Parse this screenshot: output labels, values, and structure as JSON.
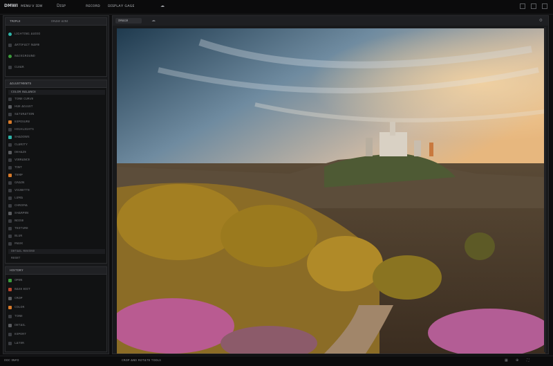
{
  "menu": {
    "app_name": "DMWI",
    "items": [
      "ᴍᴇɴᴜ",
      "ᴠ ɪᴇᴡ",
      "Dɪsᴘ"
    ],
    "info": [
      "ʀᴇᴄᴏʀᴅ",
      "ᴅɪsᴘʟᴀʏ ɢᴀɢᴇ"
    ]
  },
  "left": {
    "top_panel": {
      "title": "ᴛʀɪᴘʟᴇ",
      "tab": "ᴅʀᴀᴡ ᴀɪɴɪ",
      "rows": [
        {
          "label": "ʟɪɢʜᴛɪɴɢ ᴀᴜᴅɪᴏ",
          "value": ""
        },
        {
          "label": "ᴀʀᴛɪғᴀᴄᴛ ɴᴀᴍᴇ",
          "value": ""
        },
        {
          "label": "ʙᴀᴄᴋɢʀᴏᴜɴᴅ",
          "value": ""
        },
        {
          "label": "ᴄʟᴇᴀʀ",
          "value": ""
        }
      ]
    },
    "layers_panel": {
      "title": "ᴀᴅᴊᴜsᴛᴍᴇɴᴛs",
      "section": "ᴄᴏʟᴏʀ ʙᴀʟᴀɴᴄᴇ",
      "rows": [
        {
          "label": "ᴛᴏɴᴇ ᴄᴜʀᴠᴇ",
          "value": ""
        },
        {
          "label": "ʜᴜᴇ ᴀᴅᴊᴜsᴛ",
          "value": ""
        },
        {
          "label": "sᴀᴛᴜʀᴀᴛɪᴏɴ",
          "value": ""
        },
        {
          "label": "ᴇxᴘᴏsᴜʀᴇ",
          "value": ""
        },
        {
          "label": "ʜɪɢʜʟɪɢʜᴛs",
          "value": ""
        },
        {
          "label": "sʜᴀᴅᴏᴡs",
          "value": ""
        },
        {
          "label": "ᴄʟᴀʀɪᴛʏ",
          "value": ""
        },
        {
          "label": "ᴅᴇʜᴀᴢᴇ",
          "value": ""
        },
        {
          "label": "ᴠɪʙʀᴀɴᴄᴇ",
          "value": ""
        },
        {
          "label": "ᴛɪɴᴛ",
          "value": ""
        },
        {
          "label": "ᴛᴇᴍᴘ",
          "value": ""
        },
        {
          "label": "ɢʀᴀɪɴ",
          "value": ""
        },
        {
          "label": "ᴠɪɢɴᴇᴛᴛᴇ",
          "value": ""
        },
        {
          "label": "ʟᴜᴍᴀ",
          "value": ""
        },
        {
          "label": "ᴄʜʀᴏᴍᴀ",
          "value": ""
        },
        {
          "label": "sʜᴀʀᴘᴇɴ",
          "value": ""
        },
        {
          "label": "ɴᴏɪsᴇ",
          "value": ""
        },
        {
          "label": "ᴛᴇxᴛᴜʀᴇ",
          "value": ""
        },
        {
          "label": "ʙʟᴜʀ",
          "value": ""
        },
        {
          "label": "ᴍᴀsᴋ",
          "value": ""
        }
      ],
      "footer": "ᴅᴇᴛᴀɪʟ ʀᴇᴠɪᴇᴡ",
      "footer2": "ʀᴇsᴇᴛ"
    },
    "bottom_panel": {
      "title": "ʜɪsᴛᴏʀʏ",
      "rows": [
        {
          "label": "ᴏᴘᴇɴ",
          "value": ""
        },
        {
          "label": "ʙᴀsᴇ ᴇᴅɪᴛ",
          "value": ""
        },
        {
          "label": "ᴄʀᴏᴘ",
          "value": ""
        },
        {
          "label": "ᴄᴏʟᴏʀ",
          "value": ""
        },
        {
          "label": "ᴛᴏɴᴇ",
          "value": ""
        },
        {
          "label": "ᴅᴇᴛᴀɪʟ",
          "value": ""
        },
        {
          "label": "ᴇxᴘᴏʀᴛ",
          "value": ""
        },
        {
          "label": "ʟᴀʏᴇʀ",
          "value": ""
        }
      ]
    }
  },
  "main": {
    "tab_label": "ɪᴍᴀɢᴇ",
    "image_alt": "castle-on-hill-landscape"
  },
  "status": {
    "left": "ᴅᴏᴄ ɪɴғᴏ",
    "center": "ᴄʀᴏᴘ ᴀɴᴅ ʀᴏᴛᴀᴛᴇ ᴛᴏᴏʟs"
  },
  "colors": {
    "accent_teal": "#2fb3a8",
    "accent_green": "#3c9a3c",
    "accent_orange": "#d77a2a",
    "accent_red": "#b8452e"
  }
}
